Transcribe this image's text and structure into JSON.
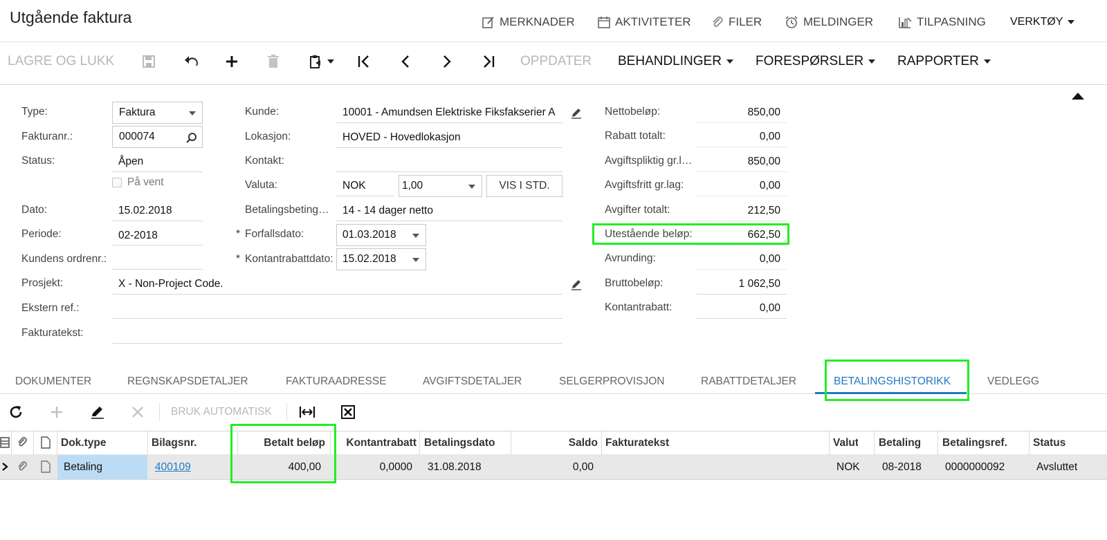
{
  "title": "Utgående faktura",
  "top_nav": {
    "notes": "MERKNADER",
    "activities": "AKTIVITETER",
    "files": "FILER",
    "notifications": "MELDINGER",
    "customization": "TILPASNING",
    "tools": "VERKTØY"
  },
  "toolbar": {
    "save_close": "LAGRE OG LUKK",
    "update": "OPPDATER",
    "actions": "BEHANDLINGER",
    "inquiries": "FORESPØRSLER",
    "reports": "RAPPORTER"
  },
  "form": {
    "type_label": "Type:",
    "type_value": "Faktura",
    "invoice_no_label": "Fakturanr.:",
    "invoice_no_value": "000074",
    "status_label": "Status:",
    "status_value": "Åpen",
    "hold_label": "På vent",
    "date_label": "Dato:",
    "date_value": "15.02.2018",
    "period_label": "Periode:",
    "period_value": "02-2018",
    "customer_order_label": "Kundens ordrenr.:",
    "customer_order_value": "",
    "project_label": "Prosjekt:",
    "project_value": "X - Non-Project Code.",
    "external_ref_label": "Ekstern ref.:",
    "external_ref_value": "",
    "invoice_text_label": "Fakturatekst:",
    "invoice_text_value": "",
    "customer_label": "Kunde:",
    "customer_value": "10001 - Amundsen Elektriske Fiksfakserier A",
    "location_label": "Lokasjon:",
    "location_value": "HOVED - Hovedlokasjon",
    "contact_label": "Kontakt:",
    "contact_value": "",
    "currency_label": "Valuta:",
    "currency_value": "NOK",
    "rate_value": "1,00",
    "view_base_button": "VIS I STD.",
    "terms_label": "Betalingsbeting…",
    "terms_value": "14 - 14 dager netto",
    "due_date_label": "Forfallsdato:",
    "due_date_value": "01.03.2018",
    "cash_discount_date_label": "Kontantrabattdato:",
    "cash_discount_date_value": "15.02.2018",
    "required_mark": "*"
  },
  "totals": [
    {
      "label": "Nettobeløp:",
      "value": "850,00"
    },
    {
      "label": "Rabatt totalt:",
      "value": "0,00"
    },
    {
      "label": "Avgiftspliktig gr.l…",
      "value": "850,00"
    },
    {
      "label": "Avgiftsfritt gr.lag:",
      "value": "0,00"
    },
    {
      "label": "Avgifter totalt:",
      "value": "212,50"
    },
    {
      "label": "Utestående beløp:",
      "value": "662,50"
    },
    {
      "label": "Avrunding:",
      "value": "0,00"
    },
    {
      "label": "Bruttobeløp:",
      "value": "1 062,50"
    },
    {
      "label": "Kontantrabatt:",
      "value": "0,00"
    }
  ],
  "tabs": [
    {
      "label": "DOKUMENTER"
    },
    {
      "label": "REGNSKAPSDETALJER"
    },
    {
      "label": "FAKTURAADRESSE"
    },
    {
      "label": "AVGIFTSDETALJER"
    },
    {
      "label": "SELGERPROVISJON"
    },
    {
      "label": "RABATTDETALJER"
    },
    {
      "label": "BETALINGSHISTORIKK"
    },
    {
      "label": "VEDLEGG"
    }
  ],
  "grid_toolbar": {
    "auto_apply": "BRUK AUTOMATISK"
  },
  "grid": {
    "headers": {
      "doc_type": "Dok.type",
      "ref_no": "Bilagsnr.",
      "amount_paid": "Betalt beløp",
      "cash_discount": "Kontantrabatt",
      "payment_date": "Betalingsdato",
      "balance": "Saldo",
      "description": "Fakturatekst",
      "currency": "Valuta",
      "payment_period": "Betaling",
      "payment_ref": "Betalingsref.",
      "status": "Status"
    },
    "row": {
      "doc_type": "Betaling",
      "ref_no": "400109",
      "amount_paid": "400,00",
      "cash_discount": "0,0000",
      "payment_date": "31.08.2018",
      "balance": "0,00",
      "description": "",
      "currency": "NOK",
      "payment_period": "08-2018",
      "payment_ref": "0000000092",
      "status": "Avsluttet"
    }
  },
  "colors": {
    "highlight": "#22ee22",
    "active_tab": "#1f78c8",
    "selected_cell": "#bcdcf5",
    "link": "#1f78c8"
  }
}
